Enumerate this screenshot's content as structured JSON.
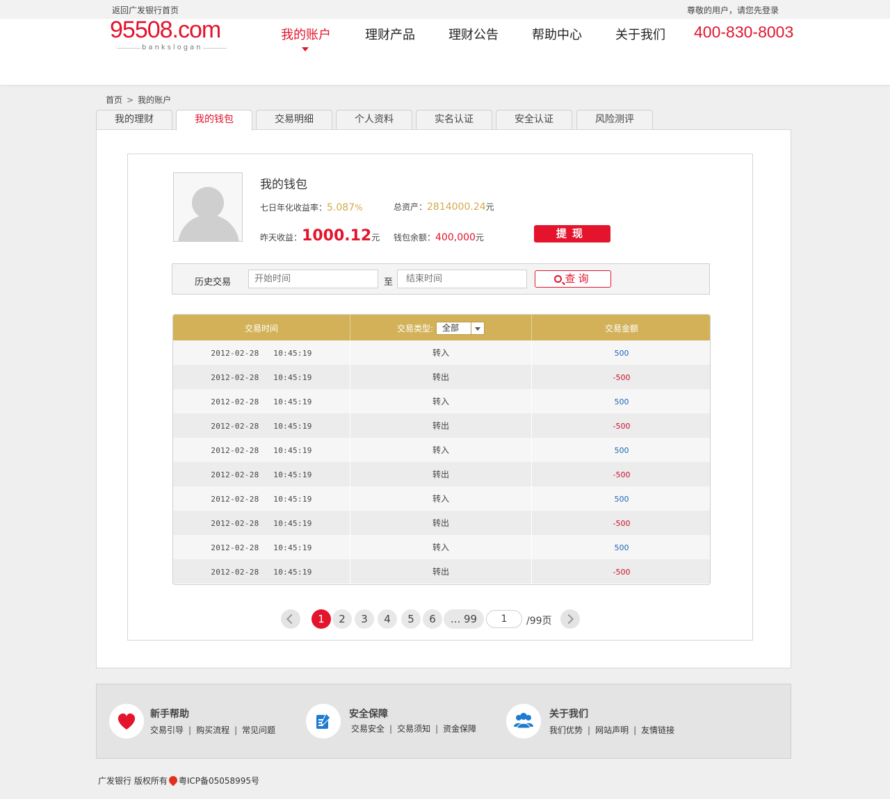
{
  "topbar": {
    "back_link": "返回广发银行首页",
    "login_text": "尊敬的用户，请您先登录"
  },
  "logo": {
    "text": "95508.com",
    "slogan": "bankslogan"
  },
  "nav": [
    {
      "label": "我的账户",
      "active": true
    },
    {
      "label": "理财产品",
      "active": false
    },
    {
      "label": "理财公告",
      "active": false
    },
    {
      "label": "帮助中心",
      "active": false
    },
    {
      "label": "关于我们",
      "active": false
    }
  ],
  "phone": "400-830-8003",
  "breadcrumb": {
    "home": "首页",
    "current": "我的账户"
  },
  "tabs": [
    "我的理财",
    "我的钱包",
    "交易明细",
    "个人资料",
    "实名认证",
    "安全认证",
    "风险测评"
  ],
  "active_tab": "我的钱包",
  "wallet": {
    "title": "我的钱包",
    "yield_label": "七日年化收益率：",
    "yield_value": "5.087",
    "yield_unit": "%",
    "total_label": "总资产：",
    "total_value": "2814000.24",
    "total_unit": "元",
    "yesterday_label": "昨天收益：",
    "yesterday_value": "1000.12",
    "yesterday_unit": "元",
    "balance_label": "钱包余额：",
    "balance_value": "400,000",
    "balance_unit": "元",
    "withdraw_label": "提现"
  },
  "search": {
    "label": "历史交易",
    "start_placeholder": "开始时间",
    "to": "至",
    "end_placeholder": "结束时间",
    "query_label": "查询"
  },
  "table": {
    "headers": {
      "time": "交易时间",
      "type": "交易类型:",
      "amount": "交易金额"
    },
    "type_filter": "全部",
    "rows": [
      {
        "time": "2012-02-28   10:45:19",
        "type": "转入",
        "amount": "500",
        "dir": "in"
      },
      {
        "time": "2012-02-28   10:45:19",
        "type": "转出",
        "amount": "-500",
        "dir": "out"
      },
      {
        "time": "2012-02-28   10:45:19",
        "type": "转入",
        "amount": "500",
        "dir": "in"
      },
      {
        "time": "2012-02-28   10:45:19",
        "type": "转出",
        "amount": "-500",
        "dir": "out"
      },
      {
        "time": "2012-02-28   10:45:19",
        "type": "转入",
        "amount": "500",
        "dir": "in"
      },
      {
        "time": "2012-02-28   10:45:19",
        "type": "转出",
        "amount": "-500",
        "dir": "out"
      },
      {
        "time": "2012-02-28   10:45:19",
        "type": "转入",
        "amount": "500",
        "dir": "in"
      },
      {
        "time": "2012-02-28   10:45:19",
        "type": "转出",
        "amount": "-500",
        "dir": "out"
      },
      {
        "time": "2012-02-28   10:45:19",
        "type": "转入",
        "amount": "500",
        "dir": "in"
      },
      {
        "time": "2012-02-28   10:45:19",
        "type": "转出",
        "amount": "-500",
        "dir": "out"
      }
    ]
  },
  "pagination": {
    "pages": [
      "1",
      "2",
      "3",
      "4",
      "5",
      "6"
    ],
    "ellipsis": "... 99",
    "current": "1",
    "input_value": "1",
    "total": "/99页"
  },
  "footer": {
    "sections": [
      {
        "title": "新手帮助",
        "icon": "heart-icon",
        "links": [
          "交易引导",
          "购买流程",
          "常见问题"
        ]
      },
      {
        "title": "安全保障",
        "icon": "document-edit-icon",
        "links": [
          "交易安全",
          "交易须知",
          "资金保障"
        ]
      },
      {
        "title": "关于我们",
        "icon": "users-icon",
        "links": [
          "我们优势",
          "网站声明",
          "友情链接"
        ]
      }
    ],
    "copyright": "广发银行  版权所有",
    "icp": "粤ICP备05058995号"
  },
  "colors": {
    "brand_red": "#e3142c",
    "gold": "#d2b158",
    "in_blue": "#1e64b4",
    "out_red": "#c8102e"
  }
}
